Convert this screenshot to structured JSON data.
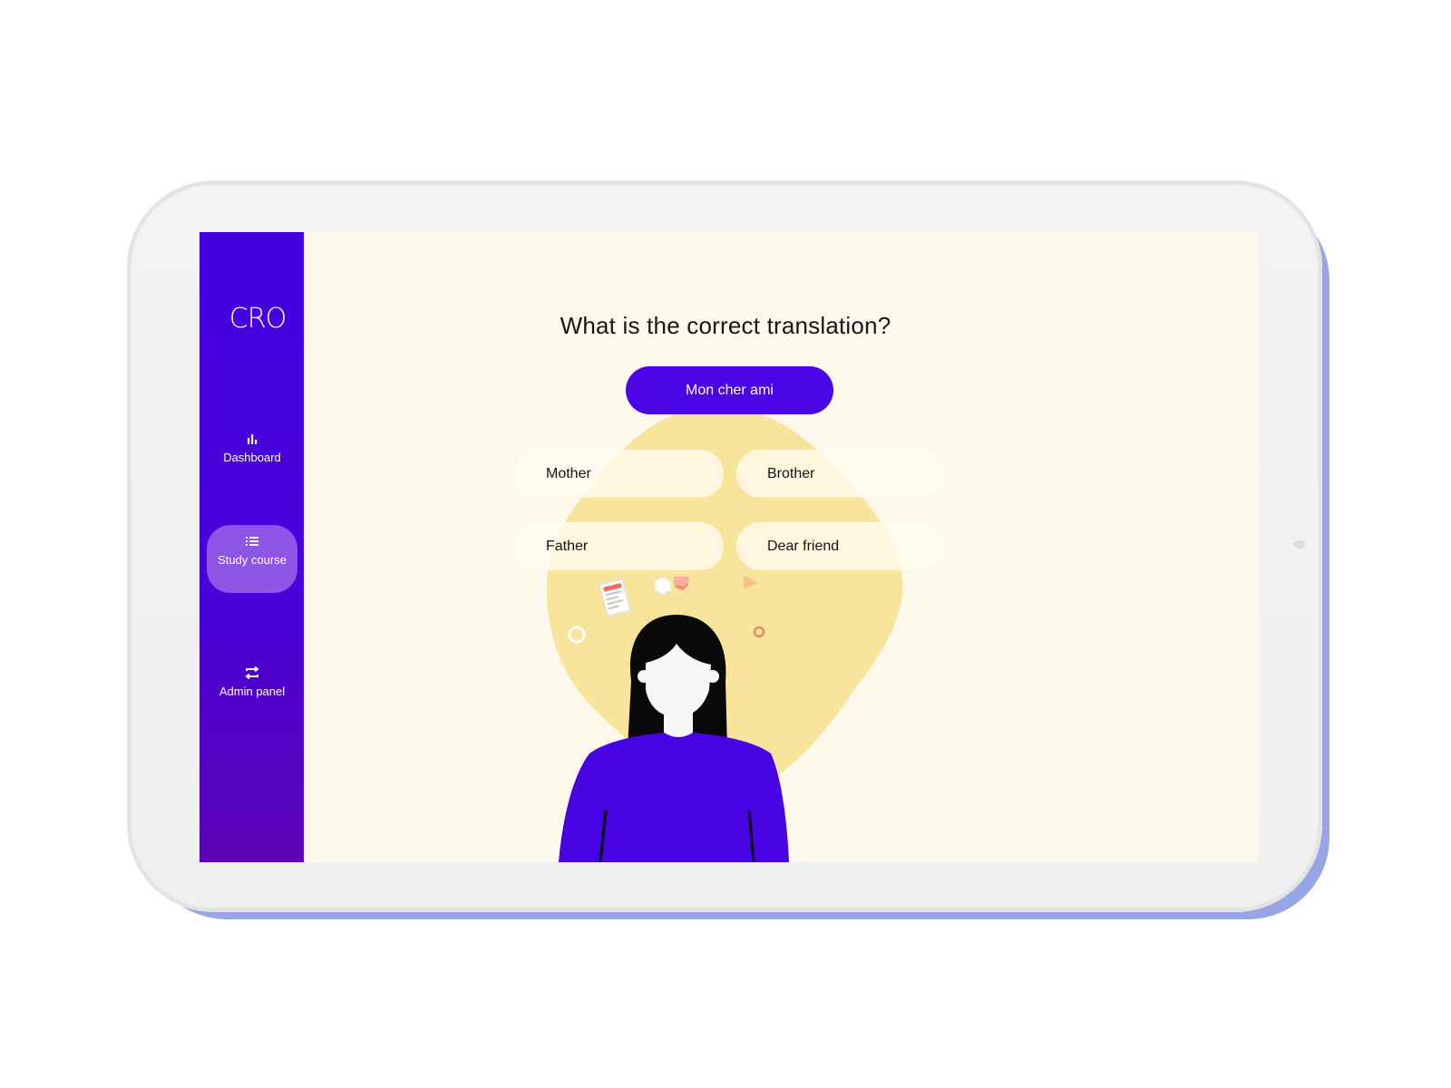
{
  "app": {
    "logo": "CRO"
  },
  "sidebar": {
    "items": [
      {
        "label": "Dashboard",
        "icon": "bar-chart-icon",
        "active": false
      },
      {
        "label": "Study course",
        "icon": "list-icon",
        "active": true
      },
      {
        "label": "Admin panel",
        "icon": "swap-arrows-icon",
        "active": false
      }
    ]
  },
  "quiz": {
    "question": "What is the correct translation?",
    "prompt": "Mon cher ami",
    "options": [
      "Mother",
      "Brother",
      "Father",
      "Dear friend"
    ]
  },
  "colors": {
    "sidebar": "#4400e0",
    "accent": "#4a04e6",
    "active_nav": "#8f55e6",
    "background": "#fdf8ec",
    "blob": "#f8e49a"
  }
}
